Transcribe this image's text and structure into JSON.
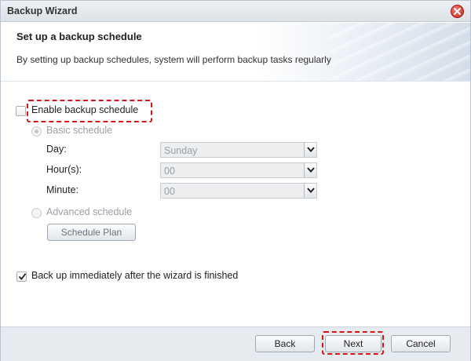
{
  "window": {
    "title": "Backup Wizard"
  },
  "header": {
    "title": "Set up a backup schedule",
    "description": "By setting up backup schedules, system will perform backup tasks regularly"
  },
  "schedule": {
    "enable_label": "Enable backup schedule",
    "enable_checked": false,
    "basic_label": "Basic schedule",
    "day_label": "Day:",
    "day_value": "Sunday",
    "hour_label": "Hour(s):",
    "hour_value": "00",
    "minute_label": "Minute:",
    "minute_value": "00",
    "advanced_label": "Advanced schedule",
    "schedule_plan_label": "Schedule Plan"
  },
  "backup_now": {
    "label": "Back up immediately after the wizard is finished",
    "checked": true
  },
  "footer": {
    "back_label": "Back",
    "next_label": "Next",
    "cancel_label": "Cancel"
  },
  "colors": {
    "highlight": "#d6151b",
    "disabled_text": "#9aa0a6"
  }
}
